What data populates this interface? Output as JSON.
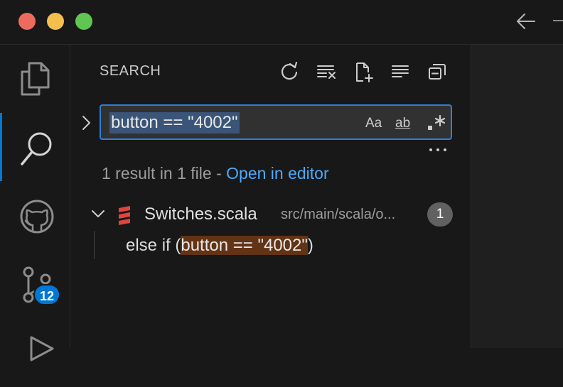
{
  "window": {
    "controls": [
      "close",
      "minimize",
      "zoom"
    ],
    "nav_back_icon": "arrow-left-icon"
  },
  "activity_bar": {
    "items": [
      {
        "name": "explorer",
        "icon": "files-icon"
      },
      {
        "name": "search",
        "icon": "search-icon",
        "active": true
      },
      {
        "name": "github",
        "icon": "github-icon"
      },
      {
        "name": "source-control",
        "icon": "source-control-icon",
        "badge": "12"
      },
      {
        "name": "run",
        "icon": "run-icon"
      }
    ],
    "accent": "#0078d4"
  },
  "search_panel": {
    "title": "SEARCH",
    "toolbar_icons": [
      "refresh-icon",
      "clear-results-icon",
      "new-search-editor-icon",
      "view-as-tree-icon",
      "collapse-all-icon"
    ],
    "query": "button == \"4002\"",
    "options": {
      "match_case": "Aa",
      "match_whole_word": "ab",
      "use_regex": ".*"
    },
    "summary": {
      "text": "1 result in 1 file - ",
      "link": "Open in editor"
    },
    "results": [
      {
        "file": "Switches.scala",
        "path": "src/main/scala/o...",
        "count": "1",
        "matches": [
          {
            "before": "else if (",
            "match": "button == \"4002\"",
            "after": ")"
          }
        ]
      }
    ]
  },
  "colors": {
    "background": "#181818",
    "focus_border": "#2f7fd6",
    "selection": "#3a5578",
    "match_highlight": "#623315",
    "link": "#4daafc",
    "scala_icon": "#e0443e"
  }
}
